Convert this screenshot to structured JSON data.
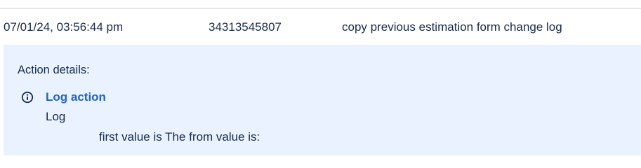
{
  "log_entry": {
    "timestamp": "07/01/24, 03:56:44 pm",
    "id": "34313545807",
    "description": "copy previous estimation form change log"
  },
  "action_details": {
    "heading": "Action details:",
    "icon": "info-icon",
    "title": "Log action",
    "type": "Log",
    "message": "first value is The from value is:"
  },
  "colors": {
    "panel_background": "#e9f2fe",
    "link": "#1f63c6",
    "text": "#172b4d",
    "divider": "#e3e6ea"
  }
}
